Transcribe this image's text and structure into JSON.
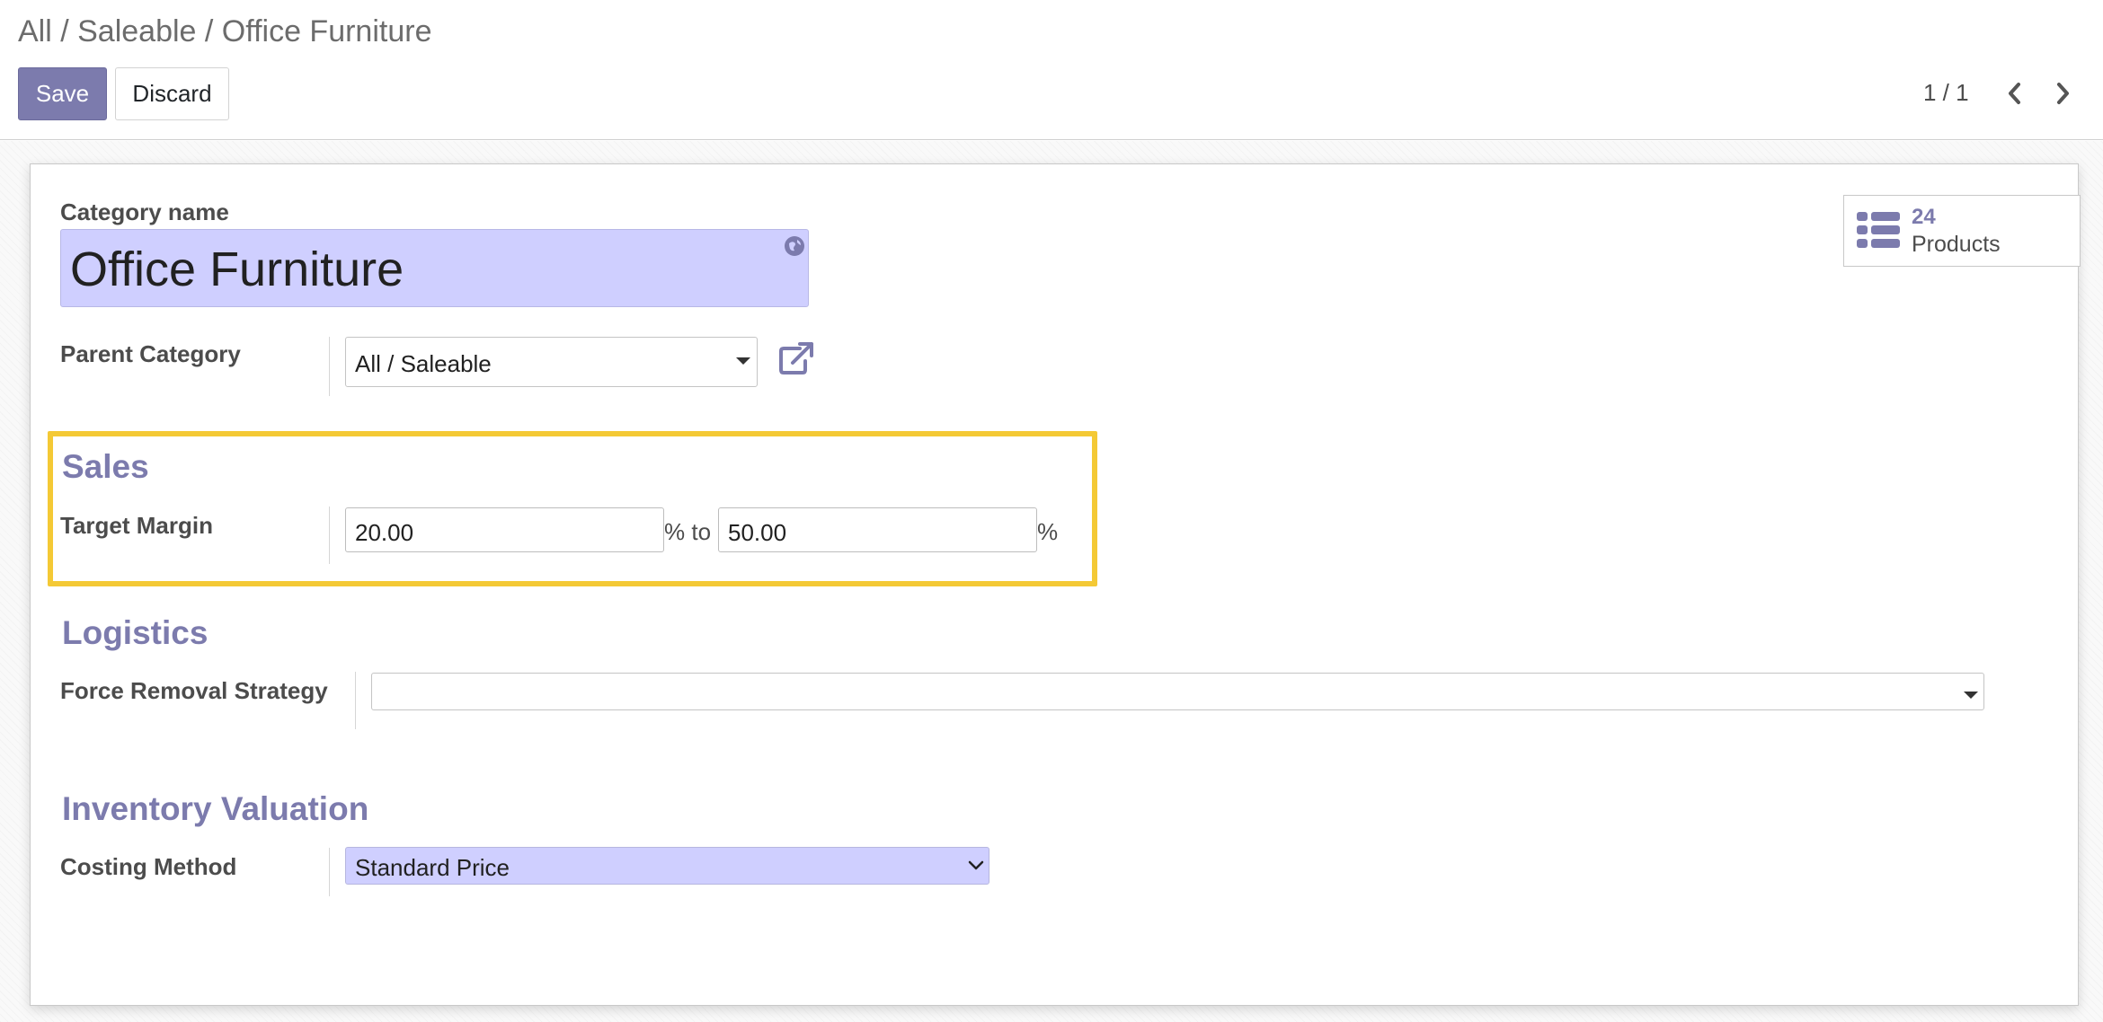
{
  "breadcrumb": "All / Saleable / Office Furniture",
  "toolbar": {
    "save_label": "Save",
    "discard_label": "Discard"
  },
  "pager": {
    "value": "1 / 1"
  },
  "stat_button": {
    "value": "24",
    "label": "Products"
  },
  "form": {
    "category_name": {
      "label": "Category name",
      "value": "Office Furniture"
    },
    "parent_category": {
      "label": "Parent Category",
      "value": "All / Saleable"
    },
    "sales": {
      "title": "Sales",
      "target_margin_label": "Target Margin",
      "margin_from": "20.00",
      "margin_to": "50.00",
      "to_text": "% to",
      "percent": "%"
    },
    "logistics": {
      "title": "Logistics",
      "removal_strategy_label": "Force Removal Strategy",
      "removal_strategy_value": ""
    },
    "inventory_valuation": {
      "title": "Inventory Valuation",
      "costing_method_label": "Costing Method",
      "costing_method_value": "Standard Price"
    }
  },
  "colors": {
    "brand": "#7c7bad",
    "input_highlight": "#cfcfff",
    "annotation": "#f4c935"
  }
}
